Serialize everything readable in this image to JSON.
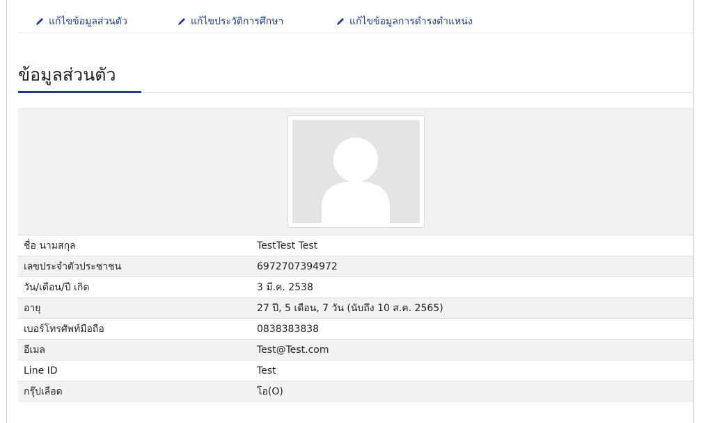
{
  "nav": {
    "edit_personal": "แก้ไขข้อมูลส่วนตัว",
    "edit_education": "แก้ไขประวัติการศึกษา",
    "edit_position": "แก้ไขข้อมูลการดำรงตำแหน่ง"
  },
  "page": {
    "heading": "ข้อมูลส่วนตัว"
  },
  "icons": {
    "nav_icon": "pencil-icon",
    "avatar": "avatar-placeholder-icon"
  },
  "colors": {
    "link": "#1d3e8a",
    "row_shade": "#f1f1f1",
    "avatar_bg": "#e4e4e4"
  },
  "rows": [
    {
      "label": "ชื่อ นามสกุล",
      "value": "TestTest Test"
    },
    {
      "label": "เลขประจำตัวประชาชน",
      "value": "6972707394972"
    },
    {
      "label": "วัน/เดือน/ปี เกิด",
      "value": "3 มี.ค. 2538"
    },
    {
      "label": "อายุ",
      "value": "27 ปี, 5 เดือน, 7 วัน (นับถึง 10 ส.ค. 2565)"
    },
    {
      "label": "เบอร์โทรศัพท์มือถือ",
      "value": "0838383838"
    },
    {
      "label": "อีเมล",
      "value": "Test@Test.com"
    },
    {
      "label": "Line ID",
      "value": "Test"
    },
    {
      "label": "กรุ๊ปเลือด",
      "value": "โอ(O)"
    }
  ]
}
